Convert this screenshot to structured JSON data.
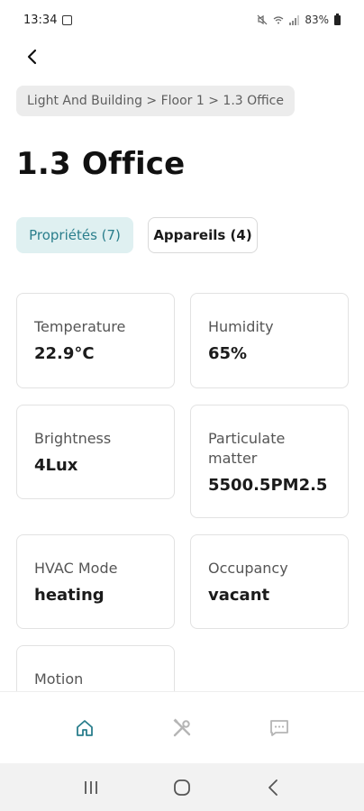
{
  "status_bar": {
    "time": "13:34",
    "battery": "83%",
    "icons": [
      "notification-icon",
      "mute-icon",
      "wifi-icon",
      "signal-icon",
      "battery-icon"
    ]
  },
  "header": {
    "back_icon": "chevron-left-icon",
    "breadcrumb": "Light And Building > Floor 1 > 1.3 Office",
    "title": "1.3 Office"
  },
  "tabs": [
    {
      "label": "Propriétés (7)",
      "active": true
    },
    {
      "label": "Appareils (4)",
      "active": false
    }
  ],
  "properties": [
    {
      "label": "Temperature",
      "value": "22.9°C"
    },
    {
      "label": "Humidity",
      "value": "65%"
    },
    {
      "label": "Brightness",
      "value": "4Lux"
    },
    {
      "label": "Particulate\nmatter",
      "value": "5500.5PM2.5"
    },
    {
      "label": "HVAC Mode",
      "value": "heating"
    },
    {
      "label": "Occupancy",
      "value": "vacant"
    },
    {
      "label": "Motion",
      "value": ""
    }
  ],
  "bottom_nav": [
    {
      "icon": "home-icon",
      "active": true
    },
    {
      "icon": "tools-icon",
      "active": false
    },
    {
      "icon": "chat-icon",
      "active": false
    }
  ],
  "system_nav": [
    "recents-icon",
    "home-circle-icon",
    "back-icon"
  ],
  "colors": {
    "accent": "#2a7e8c",
    "accent_bg": "#dff0f1",
    "breadcrumb_bg": "#ececec",
    "inactive_icon": "#b5b5b5"
  }
}
